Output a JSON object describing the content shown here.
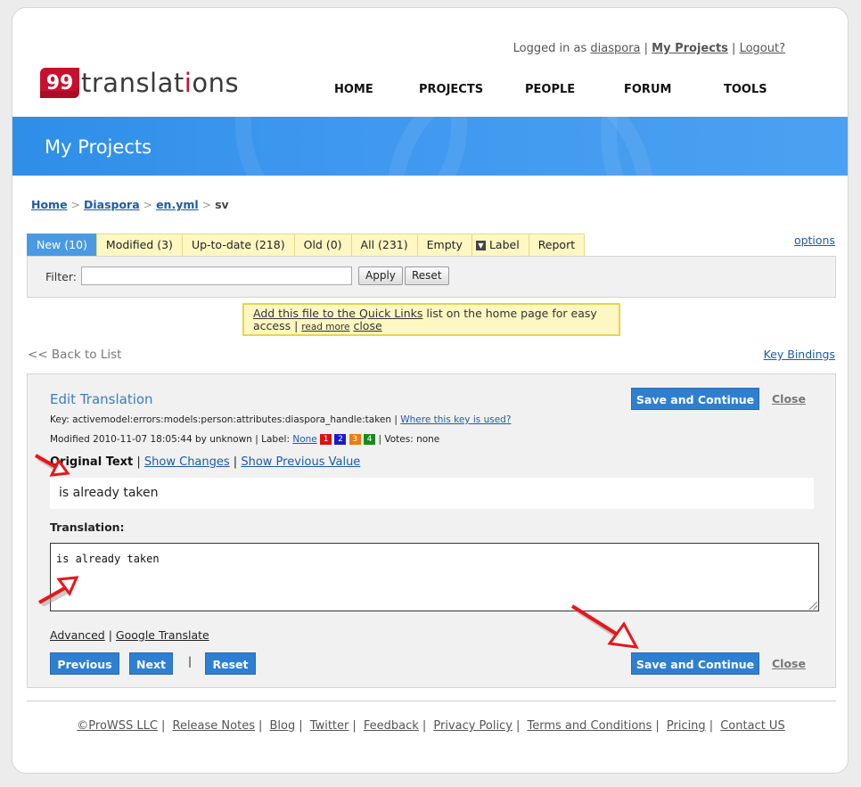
{
  "header": {
    "logo_number": "99",
    "logo_word_a": "translat",
    "logo_word_dot": "i",
    "logo_word_b": "ons",
    "logged_in_prefix": "Logged in as",
    "username": "diaspora",
    "my_projects": "My Projects",
    "logout": "Logout?",
    "nav": [
      "HOME",
      "PROJECTS",
      "PEOPLE",
      "FORUM",
      "TOOLS"
    ]
  },
  "banner": {
    "title": "My Projects"
  },
  "breadcrumb": {
    "home": "Home",
    "project": "Diaspora",
    "file": "en.yml",
    "current": "sv"
  },
  "tabs": [
    {
      "label": "New (10)",
      "active": true
    },
    {
      "label": "Modified (3)"
    },
    {
      "label": "Up-to-date (218)"
    },
    {
      "label": "Old (0)"
    },
    {
      "label": "All (231)"
    },
    {
      "label": "Empty"
    },
    {
      "label": "Label",
      "dropdown": true
    },
    {
      "label": "Report"
    }
  ],
  "options_link": "options",
  "filter": {
    "label": "Filter:",
    "value": "",
    "apply": "Apply",
    "reset": "Reset"
  },
  "notice": {
    "link": "Add this file to the Quick Links",
    "text": " list on the home page for easy access | ",
    "read_more": "read more",
    "close": "close"
  },
  "back_link": "<< Back to List",
  "key_bindings": "Key Bindings",
  "edit": {
    "title": "Edit Translation",
    "save_continue": "Save and Continue",
    "close": "Close",
    "key_text": "Key: activemodel:errors:models:person:attributes:diaspora_handle:taken |",
    "key_link": "Where this key is used?",
    "modified_text": "Modified 2010-11-07 18:05:44 by unknown | Label:",
    "label_none": "None",
    "labels": [
      {
        "text": "1",
        "color": "#d9140e"
      },
      {
        "text": "2",
        "color": "#1a1ad1"
      },
      {
        "text": "3",
        "color": "#f07a12"
      },
      {
        "text": "4",
        "color": "#1a8a1a"
      }
    ],
    "votes_text": "| Votes: none",
    "original_label": "Original Text",
    "show_changes": "Show Changes",
    "show_previous": "Show Previous Value",
    "original_text": "is already taken",
    "translation_label": "Translation:",
    "translation_value": "is already taken",
    "advanced": "Advanced",
    "google_translate": "Google Translate",
    "previous": "Previous",
    "next": "Next",
    "reset": "Reset"
  },
  "footer": [
    "©ProWSS LLC",
    "Release Notes",
    "Blog",
    "Twitter",
    "Feedback",
    "Privacy Policy",
    "Terms and Conditions",
    "Pricing",
    "Contact US"
  ],
  "colors": {
    "accent": "#2f7fd1",
    "brand_red": "#c8102e",
    "annotation_arrow": "#e8161b"
  }
}
